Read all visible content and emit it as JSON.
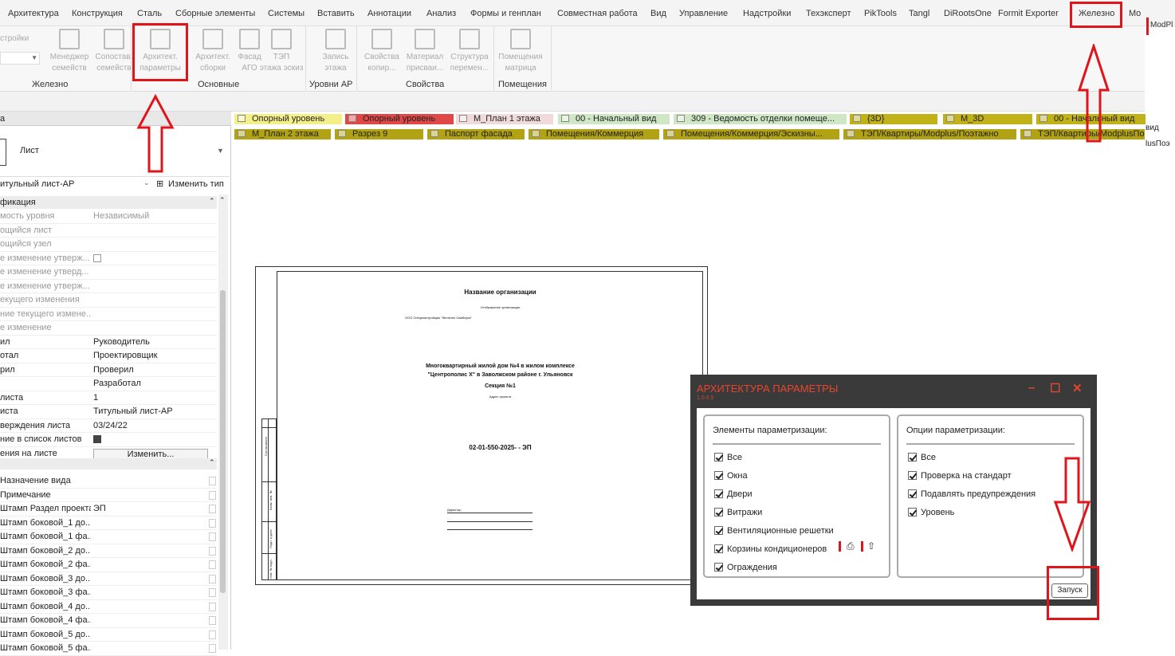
{
  "menu": [
    "Архитектура",
    "Конструкция",
    "Сталь",
    "Сборные элементы",
    "Системы",
    "Вставить",
    "Аннотации",
    "Анализ",
    "Формы и генплан",
    "Совместная работа",
    "Вид",
    "Управление",
    "Надстройки",
    "Техэксперт",
    "PikTools",
    "Tangl",
    "DiRootsOne",
    "Formit Exporter",
    "Железно",
    "Mo"
  ],
  "menu_active": "Железно",
  "menu_overflow": "ModPl",
  "ribbon": {
    "left_cut": "стройки",
    "buttons": [
      {
        "label": "Менеджер семейств",
        "icon": "family-manager-icon"
      },
      {
        "label": "Сопостав. семейств",
        "icon": "family-match-icon"
      },
      {
        "label": "Архитект. параметры",
        "icon": "arch-params-icon"
      },
      {
        "label": "Архитект. сборки",
        "icon": "arch-assembly-icon"
      },
      {
        "label": "Фасад АГО",
        "icon": "facade-icon"
      },
      {
        "label": "ТЭП этажа эскиз",
        "icon": "tep-icon"
      },
      {
        "label": "Запись этажа",
        "icon": "level-write-icon"
      },
      {
        "label": "Свойства копир...",
        "icon": "props-copy-icon"
      },
      {
        "label": "Материал присваи...",
        "icon": "material-icon"
      },
      {
        "label": "Структура перемен...",
        "icon": "structure-icon"
      },
      {
        "label": "Помещения матрица",
        "icon": "rooms-matrix-icon"
      }
    ],
    "panels": [
      "Железно",
      "Основные",
      "Уровни АР",
      "Свойства",
      "Помещения"
    ]
  },
  "props": {
    "header_cut": "а",
    "type_name": "Лист",
    "type_select": "итульный лист-АР",
    "edit_type": "Изменить тип",
    "section": "фикация",
    "rows": [
      {
        "name": "мость уровня",
        "value": "Независимый",
        "grey": true
      },
      {
        "name": "ощийся лист",
        "value": "",
        "grey": true
      },
      {
        "name": "ощийся узел",
        "value": "",
        "grey": true
      },
      {
        "name": "е изменение утверж...",
        "value": "",
        "grey": true,
        "checkbox": "off"
      },
      {
        "name": "е изменение утверд...",
        "value": "",
        "grey": true
      },
      {
        "name": "е изменение утверж...",
        "value": "",
        "grey": true
      },
      {
        "name": "екущего изменения",
        "value": "",
        "grey": true
      },
      {
        "name": "ние текущего измене...",
        "value": "",
        "grey": true
      },
      {
        "name": "е изменение",
        "value": "",
        "grey": true
      },
      {
        "name": "ил",
        "value": "Руководитель"
      },
      {
        "name": "отал",
        "value": "Проектировщик"
      },
      {
        "name": "рил",
        "value": "Проверил"
      },
      {
        "name": "",
        "value": "Разработал"
      },
      {
        "name": "листа",
        "value": "1"
      },
      {
        "name": "иста",
        "value": "Титульный лист-АР"
      },
      {
        "name": "верждения листа",
        "value": "03/24/22"
      },
      {
        "name": "ние в список листов",
        "value": "",
        "checkbox": "on"
      },
      {
        "name": "ения на листе",
        "value": "",
        "button": "Изменить..."
      }
    ],
    "rows2": [
      {
        "name": "Назначение вида",
        "value": ""
      },
      {
        "name": "Примечание",
        "value": ""
      },
      {
        "name": "Штамп Раздел проекта",
        "value": "ЭП"
      },
      {
        "name": "Штамп боковой_1 до...",
        "value": ""
      },
      {
        "name": "Штамп боковой_1 фа...",
        "value": ""
      },
      {
        "name": "Штамп боковой_2 до...",
        "value": ""
      },
      {
        "name": "Штамп боковой_2 фа...",
        "value": ""
      },
      {
        "name": "Штамп боковой_3 до...",
        "value": ""
      },
      {
        "name": "Штамп боковой_3 фа...",
        "value": ""
      },
      {
        "name": "Штамп боковой_4 до...",
        "value": ""
      },
      {
        "name": "Штамп боковой_4 фа...",
        "value": ""
      },
      {
        "name": "Штамп боковой_5 до...",
        "value": ""
      },
      {
        "name": "Штамп боковой_5 фа...",
        "value": ""
      }
    ]
  },
  "tabs_row1": [
    {
      "label": "Опорный уровень",
      "color": "#f3f08a"
    },
    {
      "label": "Опорный уровень",
      "color": "#e04848"
    },
    {
      "label": "М_План 1 этажа",
      "color": "#f0dada"
    },
    {
      "label": "00 - Начальный вид",
      "color": "#cfe7c4"
    },
    {
      "label": "309 - Ведомость отделки помеще...",
      "color": "#cfe7c4"
    },
    {
      "label": "{3D}",
      "color": "#c2b21a"
    },
    {
      "label": "М_3D",
      "color": "#c2b21a"
    },
    {
      "label": "00 - Начальный вид",
      "color": "#c2b21a"
    }
  ],
  "tabs_row2": [
    {
      "label": "М_План 2 этажа",
      "color": "#b2a314"
    },
    {
      "label": "Разрез 9",
      "color": "#b2a314"
    },
    {
      "label": "Паспорт фасада",
      "color": "#b2a314"
    },
    {
      "label": "Помещения/Коммерция",
      "color": "#b2a314"
    },
    {
      "label": "Помещения/Коммерция/Эскизны...",
      "color": "#b2a314"
    },
    {
      "label": "ТЭП/Квартиры/Modplus/Поэтажно",
      "color": "#b2a314"
    },
    {
      "label": "ТЭП/Квартиры/ModplusПо...",
      "color": "#b2a314"
    }
  ],
  "tabs_overflow": [
    "вид",
    "lusПоэ"
  ],
  "sheet": {
    "org_title": "Название организации",
    "org_sub": "Отображение организации",
    "org_name": "ООО Специзастройщик \"Железно Симбирск\"",
    "project_line1": "Многоквартирный жилой дом №4 в жилом комплексе",
    "project_line2": "\"Центрополис Х\" в Заволжском районе г. Ульяновск",
    "section": "Секция №1",
    "address": "Адрес проекта",
    "code": "02-01-550-2025- - ЭП",
    "sign_label": "Директор",
    "stamp_labels": [
      "Согласовано",
      "Взам. инв. №",
      "Подп. и дата",
      "Инв. № подл."
    ]
  },
  "dialog": {
    "title": "АРХИТЕКТУРА ПАРАМЕТРЫ",
    "version": "1.0.0.5",
    "controls": [
      "–",
      "☐",
      "✕"
    ],
    "left_head": "Элементы параметризации:",
    "left_items": [
      "Все",
      "Окна",
      "Двери",
      "Витражи",
      "Вентиляционные решетки",
      "Корзины кондиционеров",
      "Ограждения"
    ],
    "right_head": "Опции параметризации:",
    "right_items": [
      "Все",
      "Проверка на стандарт",
      "Подавлять предупреждения",
      "Уровень"
    ],
    "run": "Запуск"
  },
  "colors": {
    "accent": "#e8452c",
    "annotation": "#e0141b",
    "dialog_bg": "#3a3a3a"
  }
}
